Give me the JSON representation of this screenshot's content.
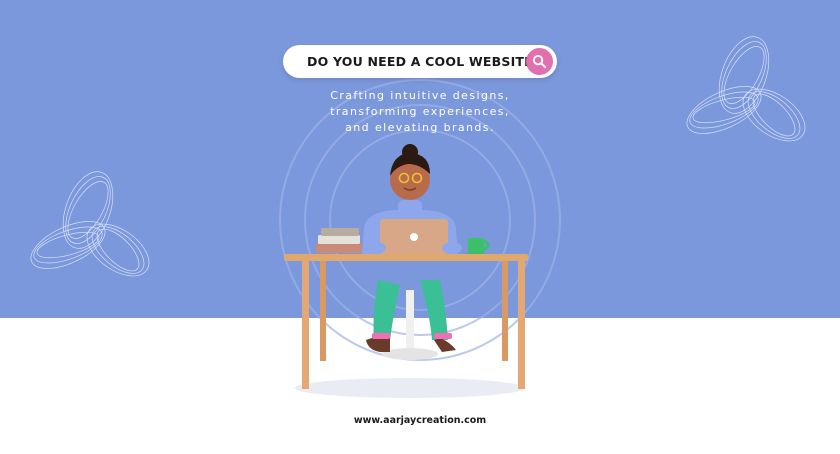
{
  "search": {
    "text": "DO YOU NEED A COOL WEBSITE ?",
    "icon": "search-icon",
    "accent_color": "#e26fae"
  },
  "tagline": {
    "line1": "Crafting intuitive designs,",
    "line2": "transforming experiences,",
    "line3": "and elevating brands."
  },
  "footer": {
    "url": "www.aarjaycreation.com"
  },
  "colors": {
    "background_top": "#7c98dc",
    "background_bottom": "#ffffff"
  }
}
